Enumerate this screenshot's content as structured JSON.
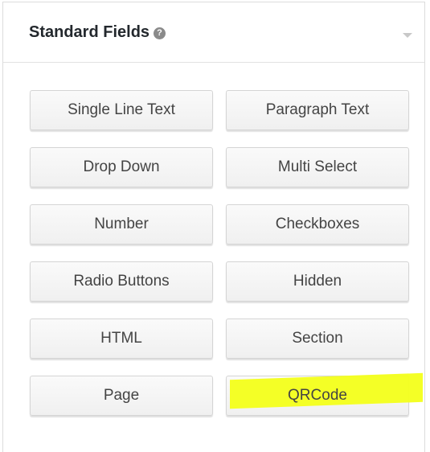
{
  "panel": {
    "title": "Standard Fields",
    "help_icon": "question-mark-icon",
    "toggle_icon": "collapse-arrow-icon"
  },
  "fields": [
    {
      "label": "Single Line Text"
    },
    {
      "label": "Paragraph Text"
    },
    {
      "label": "Drop Down"
    },
    {
      "label": "Multi Select"
    },
    {
      "label": "Number"
    },
    {
      "label": "Checkboxes"
    },
    {
      "label": "Radio Buttons"
    },
    {
      "label": "Hidden"
    },
    {
      "label": "HTML"
    },
    {
      "label": "Section"
    },
    {
      "label": "Page"
    },
    {
      "label": "QRCode",
      "highlighted": true
    }
  ],
  "colors": {
    "highlight": "#f3ff1a",
    "button_text": "#444444",
    "title_text": "#23282d"
  }
}
